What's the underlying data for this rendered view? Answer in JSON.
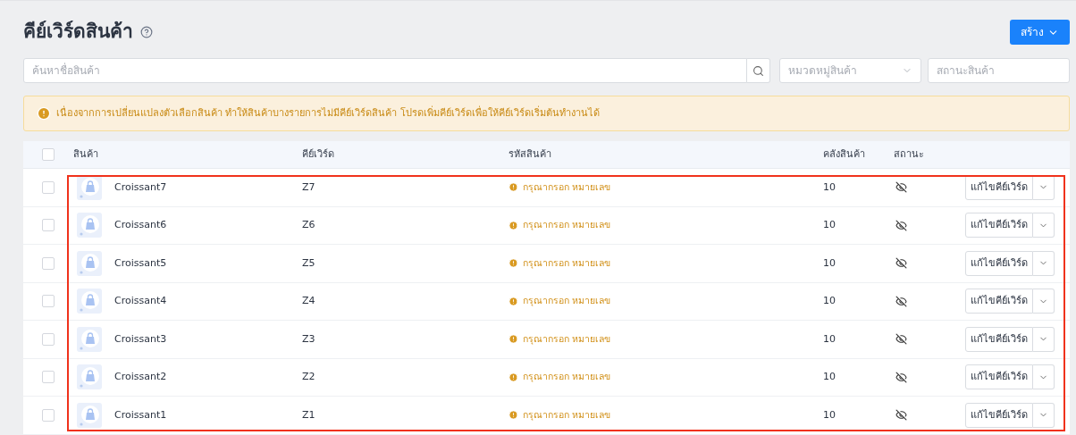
{
  "header": {
    "title": "คีย์เวิร์ดสินค้า",
    "create_button": "สร้าง"
  },
  "filters": {
    "search": {
      "placeholder": "ค้นหาชื่อสินค้า"
    },
    "category": {
      "placeholder": "หมวดหมู่สินค้า"
    },
    "status": {
      "placeholder": "สถานะสินค้า"
    }
  },
  "alert": {
    "message": "เนื่องจากการเปลี่ยนแปลงตัวเลือกสินค้า ทำให้สินค้าบางรายการไม่มีคีย์เวิร์ดสินค้า โปรดเพิ่มคีย์เวิร์ดเพื่อให้คีย์เวิร์ดเริ่มต้นทำงานได้"
  },
  "table": {
    "select_all_checked": false,
    "columns": [
      "สินค้า",
      "คีย์เวิร์ด",
      "รหัสสินค้า",
      "คลังสินค้า",
      "สถานะ"
    ],
    "rows": [
      {
        "product": "Croissant7",
        "keyword": "Z7",
        "code_warning": "กรุณากรอก หมายเลข",
        "stock": "10",
        "visible": false,
        "checked": false,
        "action": "แก้ไขคีย์เวิร์ด"
      },
      {
        "product": "Croissant6",
        "keyword": "Z6",
        "code_warning": "กรุณากรอก หมายเลข",
        "stock": "10",
        "visible": false,
        "checked": false,
        "action": "แก้ไขคีย์เวิร์ด"
      },
      {
        "product": "Croissant5",
        "keyword": "Z5",
        "code_warning": "กรุณากรอก หมายเลข",
        "stock": "10",
        "visible": false,
        "checked": false,
        "action": "แก้ไขคีย์เวิร์ด"
      },
      {
        "product": "Croissant4",
        "keyword": "Z4",
        "code_warning": "กรุณากรอก หมายเลข",
        "stock": "10",
        "visible": false,
        "checked": false,
        "action": "แก้ไขคีย์เวิร์ด"
      },
      {
        "product": "Croissant3",
        "keyword": "Z3",
        "code_warning": "กรุณากรอก หมายเลข",
        "stock": "10",
        "visible": false,
        "checked": false,
        "action": "แก้ไขคีย์เวิร์ด"
      },
      {
        "product": "Croissant2",
        "keyword": "Z2",
        "code_warning": "กรุณากรอก หมายเลข",
        "stock": "10",
        "visible": false,
        "checked": false,
        "action": "แก้ไขคีย์เวิร์ด"
      },
      {
        "product": "Croissant1",
        "keyword": "Z1",
        "code_warning": "กรุณากรอก หมายเลข",
        "stock": "10",
        "visible": false,
        "checked": false,
        "action": "แก้ไขคีย์เวิร์ด"
      }
    ]
  },
  "highlight": {
    "shown": true
  }
}
